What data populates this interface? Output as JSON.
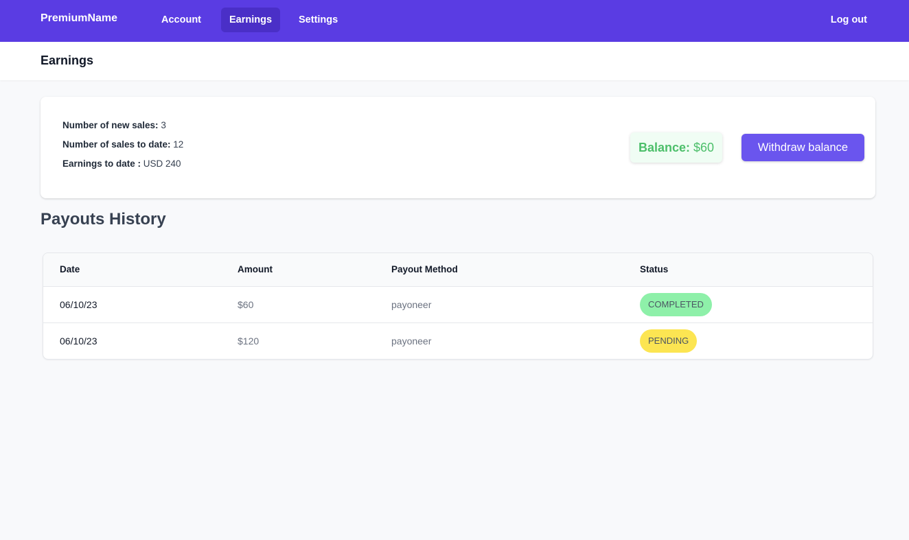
{
  "nav": {
    "brand": "PremiumName",
    "links": [
      {
        "label": "Account",
        "active": false
      },
      {
        "label": "Earnings",
        "active": true
      },
      {
        "label": "Settings",
        "active": false
      }
    ],
    "logout": "Log out"
  },
  "header": {
    "title": "Earnings"
  },
  "summary": {
    "new_sales_label": "Number of new sales:",
    "new_sales_value": "3",
    "sales_to_date_label": "Number of sales to date:",
    "sales_to_date_value": "12",
    "earnings_label": "Earnings to date :",
    "earnings_value": "USD 240",
    "balance_label": "Balance:",
    "balance_value": "$60",
    "withdraw_label": "Withdraw balance"
  },
  "payouts": {
    "title": "Payouts History",
    "columns": [
      "Date",
      "Amount",
      "Payout Method",
      "Status"
    ],
    "rows": [
      {
        "date": "06/10/23",
        "amount": "$60",
        "method": "payoneer",
        "status": "COMPLETED"
      },
      {
        "date": "06/10/23",
        "amount": "$120",
        "method": "payoneer",
        "status": "PENDING"
      }
    ]
  },
  "colors": {
    "nav_bg": "#5a3ce3",
    "nav_active": "#4a2fc7",
    "accent_button": "#6a55ee",
    "balance_text": "#4cbf6a",
    "status_completed": "#8ef0a9",
    "status_pending": "#fce552"
  }
}
